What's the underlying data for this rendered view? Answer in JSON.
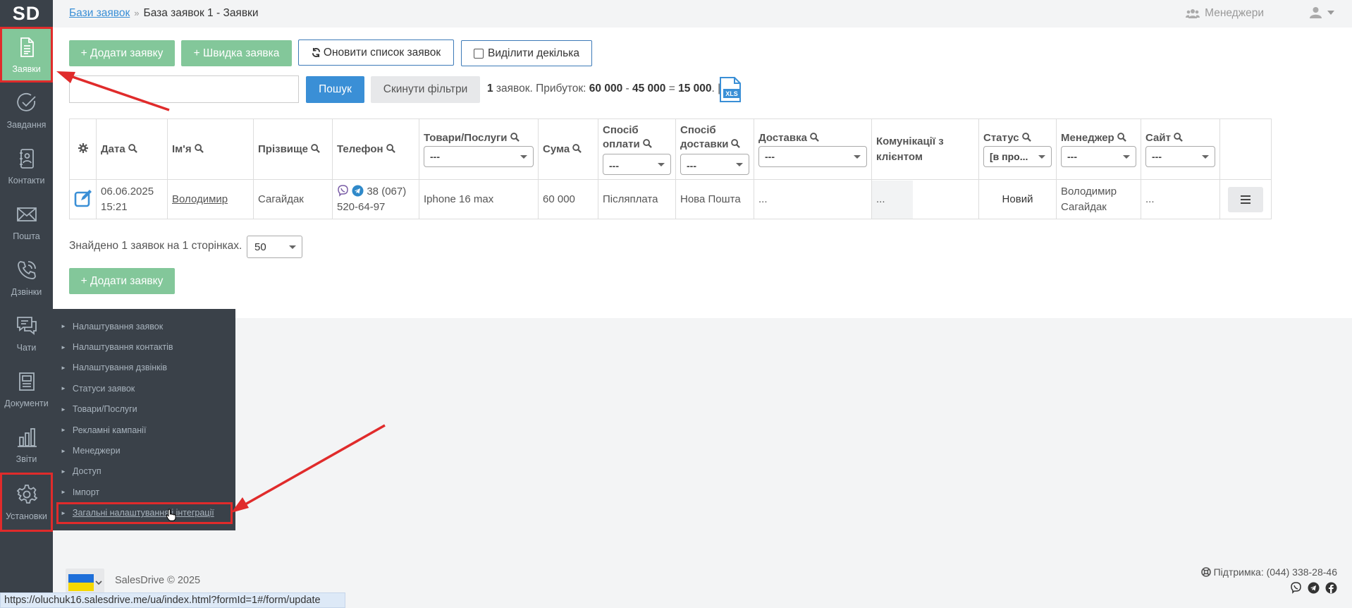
{
  "logo": "SD",
  "sidebar": {
    "items": [
      {
        "label": "Заявки",
        "icon": "document-icon"
      },
      {
        "label": "Завдання",
        "icon": "check-circle-icon"
      },
      {
        "label": "Контакти",
        "icon": "contacts-icon"
      },
      {
        "label": "Пошта",
        "icon": "mail-icon"
      },
      {
        "label": "Дзвінки",
        "icon": "phone-icon"
      },
      {
        "label": "Чати",
        "icon": "chat-icon"
      },
      {
        "label": "Документи",
        "icon": "documents-icon"
      },
      {
        "label": "Звіти",
        "icon": "bar-chart-icon"
      },
      {
        "label": "Установки",
        "icon": "gear-icon"
      }
    ]
  },
  "breadcrumb": {
    "parent": "Бази заявок",
    "separator": "»",
    "current": "База заявок 1 - Заявки"
  },
  "header": {
    "managers": "Менеджери"
  },
  "toolbar": {
    "add": "+ Додати заявку",
    "quick": "+ Швидка заявка",
    "refresh": "Оновити список заявок",
    "multi": "Виділити декілька",
    "search_placeholder": "",
    "search": "Пошук",
    "reset": "Скинути фільтри"
  },
  "summary": {
    "count": "1",
    "count_text": " заявок. Прибуток: ",
    "income": "60 000",
    "minus": " - ",
    "cost": "45 000",
    "eq": " = ",
    "profit": "15 000",
    "tail": ". |",
    "xls": "XLS"
  },
  "table": {
    "headers": {
      "date": "Дата",
      "name": "Ім'я",
      "surname": "Прізвище",
      "phone": "Телефон",
      "products": "Товари/Послуги",
      "sum": "Сума",
      "payment": "Спосіб оплати",
      "delivery_method": "Спосіб доставки",
      "delivery": "Доставка",
      "communications": "Комунікації з клієнтом",
      "status": "Статус",
      "manager": "Менеджер",
      "site": "Сайт"
    },
    "filters": {
      "products": "---",
      "payment": "---",
      "delivery_method": "---",
      "delivery": "---",
      "status": "[в про...",
      "manager": "---",
      "site": "---"
    },
    "row": {
      "date": "06.06.2025",
      "time": "15:21",
      "name": "Володимир",
      "surname": "Сагайдак",
      "phone1": "38 (067)",
      "phone2": "520-64-97",
      "products": "Iphone 16 max",
      "sum": "60 000",
      "payment": "Післяплата",
      "delivery_method": "Нова Пошта",
      "delivery": "...",
      "communications": "...",
      "status": "Новий",
      "manager1": "Володимир",
      "manager2": "Сагайдак",
      "site": "..."
    }
  },
  "found_text": "Знайдено 1 заявок на 1 сторінках.",
  "per_page": "50",
  "add_bottom": "+ Додати заявку",
  "submenu": [
    "Налаштування заявок",
    "Налаштування контактів",
    "Налаштування дзвінків",
    "Статуси заявок",
    "Товари/Послуги",
    "Рекламні кампанії",
    "Менеджери",
    "Доступ",
    "Імпорт",
    "Загальні налаштування і інтеграції"
  ],
  "footer": {
    "copyright": "SalesDrive © 2025",
    "support": "Підтримка: (044) 338-28-46"
  },
  "status_url": "https://oluchuk16.salesdrive.me/ua/index.html?formId=1#/form/update",
  "colors": {
    "green": "#83c79a",
    "blue": "#3a8fd6",
    "sidebar": "#3a4149",
    "highlight": "#e02b2b"
  }
}
